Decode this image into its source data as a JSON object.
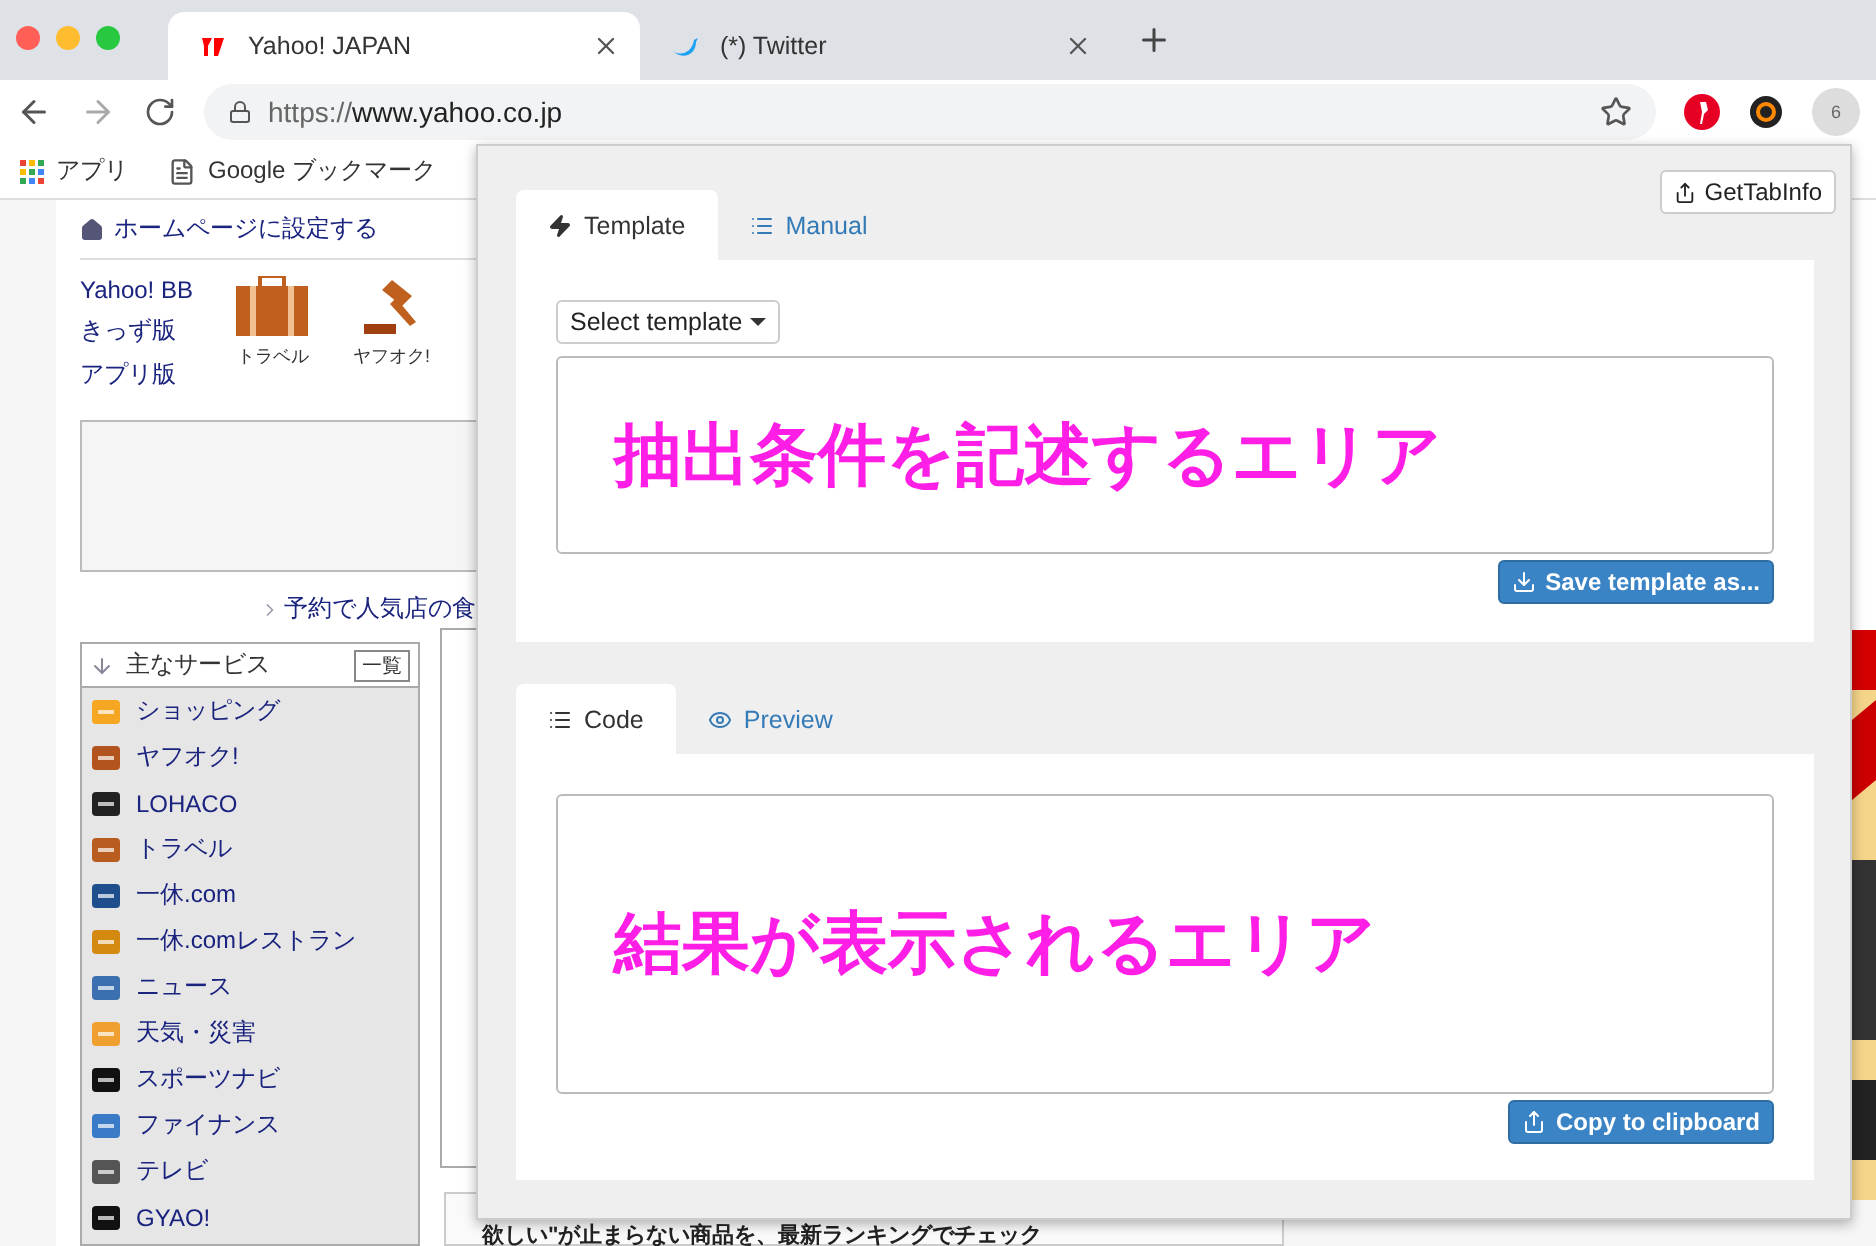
{
  "browser": {
    "tabs": [
      {
        "title": "Yahoo! JAPAN",
        "selected": true
      },
      {
        "title": "(*) Twitter",
        "selected": false
      }
    ],
    "url_scheme": "https://",
    "url_host": "www.yahoo.co.jp",
    "extension_badge": "6",
    "bookmarks": [
      "アプリ",
      "Google ブックマーク"
    ]
  },
  "page": {
    "homepage_link": "ホームページに設定する",
    "links": [
      "Yahoo! BB",
      "きっず版",
      "アプリ版"
    ],
    "quick_icons": [
      "トラベル",
      "ヤフオク!"
    ],
    "promo_link": "予約で人気店の食",
    "services": {
      "title": "主なサービス",
      "all_button": "一覧",
      "items": [
        {
          "label": "ショッピング"
        },
        {
          "label": "ヤフオク!"
        },
        {
          "label": "LOHACO"
        },
        {
          "label": "トラベル"
        },
        {
          "label": "一休.com"
        },
        {
          "label": "一休.comレストラン"
        },
        {
          "label": "ニュース"
        },
        {
          "label": "天気・災害"
        },
        {
          "label": "スポーツナビ"
        },
        {
          "label": "ファイナンス"
        },
        {
          "label": "テレビ"
        },
        {
          "label": "GYAO!"
        }
      ]
    },
    "bottom_banner": "欲しい\"が止まらない商品を、最新ランキングでチェック"
  },
  "popup": {
    "get_button": "GetTabInfo",
    "top_tabs": [
      {
        "label": "Template",
        "selected": true
      },
      {
        "label": "Manual",
        "selected": false
      }
    ],
    "select_button": "Select template",
    "template_area": "抽出条件を記述するエリア",
    "save_button": "Save template as...",
    "bottom_tabs": [
      {
        "label": "Code",
        "selected": true
      },
      {
        "label": "Preview",
        "selected": false
      }
    ],
    "code_area": "結果が表示されるエリア",
    "copy_button": "Copy to clipboard"
  }
}
